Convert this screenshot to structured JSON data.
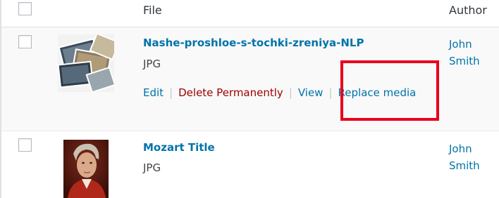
{
  "table": {
    "columns": {
      "file": "File",
      "author": "Author"
    },
    "rows": [
      {
        "title": "Nashe-proshloe-s-tochki-zreniya-NLP",
        "type": "JPG",
        "author_first": "John",
        "author_last": "Smith",
        "actions": {
          "edit": "Edit",
          "delete": "Delete Permanently",
          "view": "View",
          "replace": "Replace media"
        }
      },
      {
        "title": "Mozart Title",
        "type": "JPG",
        "author_first": "John",
        "author_last": "Smith"
      }
    ]
  },
  "separator": "|",
  "colors": {
    "link": "#0073aa",
    "delete": "#a00000",
    "highlight": "#e8001c"
  }
}
